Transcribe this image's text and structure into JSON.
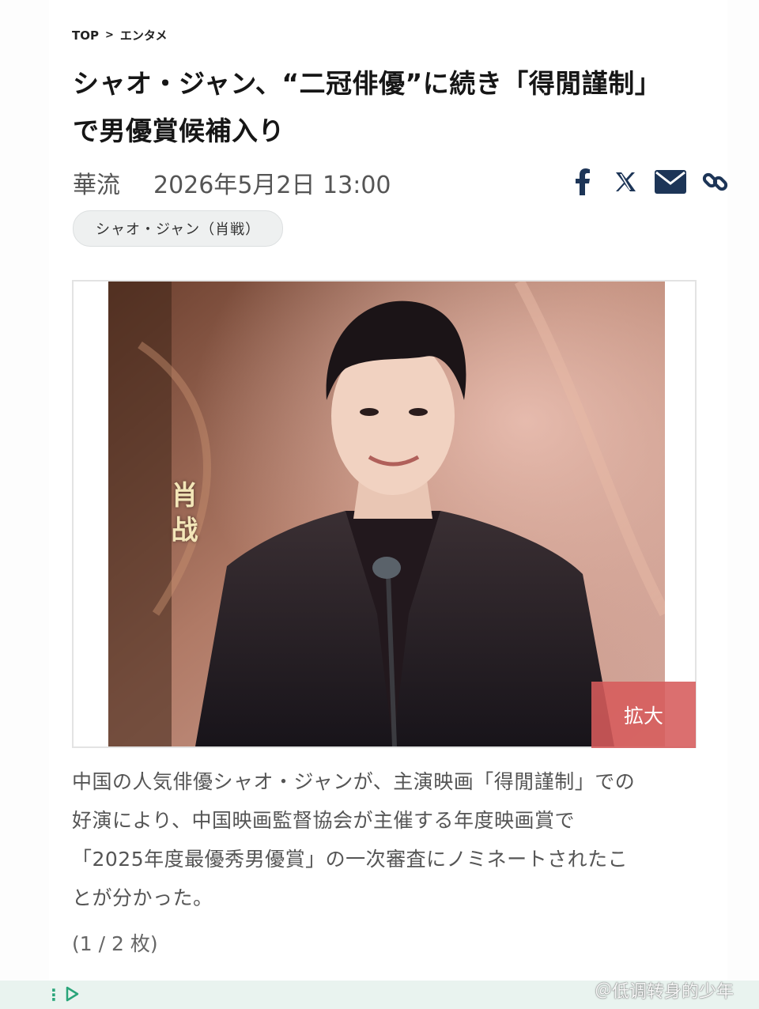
{
  "breadcrumb": {
    "home": "TOP",
    "separator": ">",
    "section": "エンタメ"
  },
  "article": {
    "title_line1": "シャオ・ジャン、“二冠俳優”に続き「得閒謹制」",
    "title_line2": "で男優賞候補入り",
    "source": "華流",
    "datetime": "2026年5月2日 13:00",
    "tag": "シャオ・ジャン（肖戦）",
    "photo_caption_overlay": "肖战",
    "zoom_label": "拡大",
    "body_line1": "中国の人気俳優シャオ・ジャンが、主演映画「得閒謹制」での",
    "body_line2": "好演により、中国映画監督協会が主催する年度映画賞で",
    "body_line3": "「2025年度最優秀男優賞」の一次審査にノミネートされたこ",
    "body_line4": "とが分かった。",
    "image_counter": "(1 / 2 枚)"
  },
  "share": {
    "icons": [
      "facebook-icon",
      "x-icon",
      "mail-icon",
      "link-icon"
    ],
    "color": "#1d3557"
  },
  "watermark": "＠低调转身的少年",
  "colors": {
    "zoom_button": "#d65b5b",
    "tag_bg": "#eef0f0",
    "bottom_bar": "#e9f3ef",
    "accent_green": "#2aa57a"
  }
}
